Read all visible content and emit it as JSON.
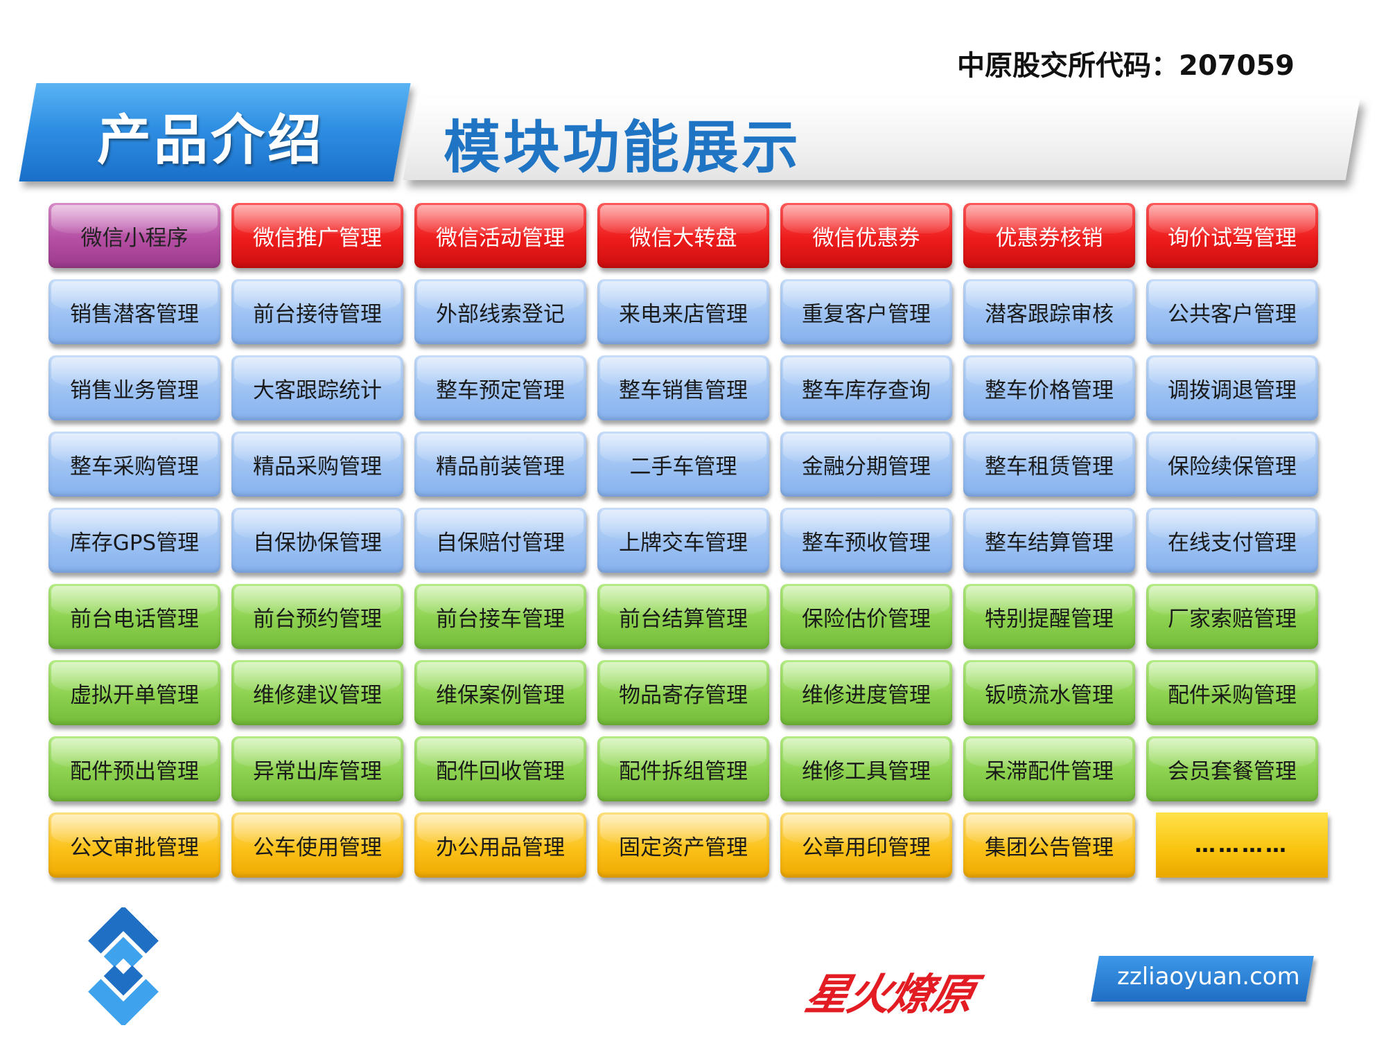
{
  "header": {
    "stock_code": "中原股交所代码：207059",
    "section": "产品介绍",
    "title": "模块功能展示"
  },
  "modules": [
    [
      "微信小程序",
      "微信推广管理",
      "微信活动管理",
      "微信大转盘",
      "微信优惠券",
      "优惠券核销",
      "询价试驾管理"
    ],
    [
      "销售潜客管理",
      "前台接待管理",
      "外部线索登记",
      "来电来店管理",
      "重复客户管理",
      "潜客跟踪审核",
      "公共客户管理"
    ],
    [
      "销售业务管理",
      "大客跟踪统计",
      "整车预定管理",
      "整车销售管理",
      "整车库存查询",
      "整车价格管理",
      "调拨调退管理"
    ],
    [
      "整车采购管理",
      "精品采购管理",
      "精品前装管理",
      "二手车管理",
      "金融分期管理",
      "整车租赁管理",
      "保险续保管理"
    ],
    [
      "库存GPS管理",
      "自保协保管理",
      "自保赔付管理",
      "上牌交车管理",
      "整车预收管理",
      "整车结算管理",
      "在线支付管理"
    ],
    [
      "前台电话管理",
      "前台预约管理",
      "前台接车管理",
      "前台结算管理",
      "保险估价管理",
      "特别提醒管理",
      "厂家索赔管理"
    ],
    [
      "虚拟开单管理",
      "维修建议管理",
      "维保案例管理",
      "物品寄存管理",
      "维修进度管理",
      "钣喷流水管理",
      "配件采购管理"
    ],
    [
      "配件预出管理",
      "异常出库管理",
      "配件回收管理",
      "配件拆组管理",
      "维修工具管理",
      "呆滞配件管理",
      "会员套餐管理"
    ],
    [
      "公文审批管理",
      "公车使用管理",
      "办公用品管理",
      "固定资产管理",
      "公章用印管理",
      "集团公告管理",
      "…………"
    ]
  ],
  "footer": {
    "logo_icon": "company-logo-icon",
    "slogan": "星火燎原",
    "website": "zzliaoyuan.com"
  },
  "colors": {
    "purple": "#b54fa4",
    "red": "#ee1c1c",
    "blue": "#9dc2f3",
    "green": "#8cd14f",
    "yellow": "#fbc21a",
    "brand_blue": "#1f74c4"
  }
}
